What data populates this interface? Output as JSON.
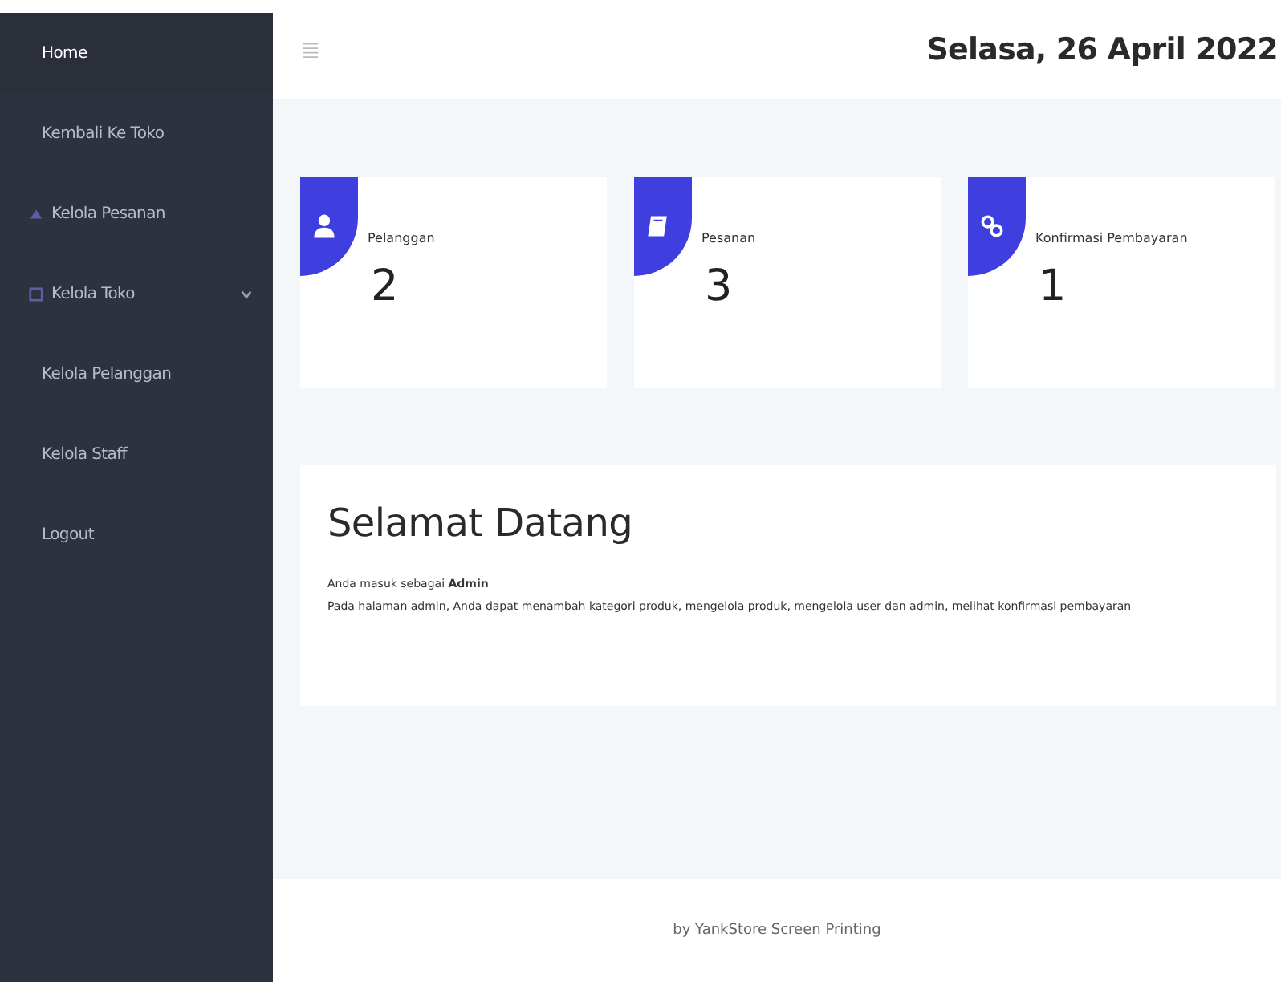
{
  "sidebar": {
    "items": [
      {
        "label": "Home",
        "kind": "plain",
        "selected": true
      },
      {
        "label": "Kembali Ke Toko",
        "kind": "plain",
        "selected": false
      },
      {
        "label": "Kelola Pesanan",
        "kind": "icon",
        "selected": false
      },
      {
        "label": "Kelola Toko",
        "kind": "group",
        "selected": false
      },
      {
        "label": "Kelola Pelanggan",
        "kind": "plain",
        "selected": false
      },
      {
        "label": "Kelola Staff",
        "kind": "plain",
        "selected": false
      },
      {
        "label": "Logout",
        "kind": "plain",
        "selected": false
      }
    ]
  },
  "header": {
    "date": "Selasa, 26 April 2022"
  },
  "stats": [
    {
      "kind": "user",
      "label": "Pelanggan",
      "value": "2"
    },
    {
      "kind": "book",
      "label": "Pesanan",
      "value": "3"
    },
    {
      "kind": "link",
      "label": "Konfirmasi Pembayaran",
      "value": "1"
    }
  ],
  "welcome": {
    "title": "Selamat Datang",
    "role_line": "Anda masuk sebagai **Admin**",
    "description": "Pada halaman admin, Anda dapat menambah kategori produk, mengelola produk, mengelola user dan admin, melihat konfirmasi pembayaran"
  },
  "footer": "by YankStore Screen Printing"
}
